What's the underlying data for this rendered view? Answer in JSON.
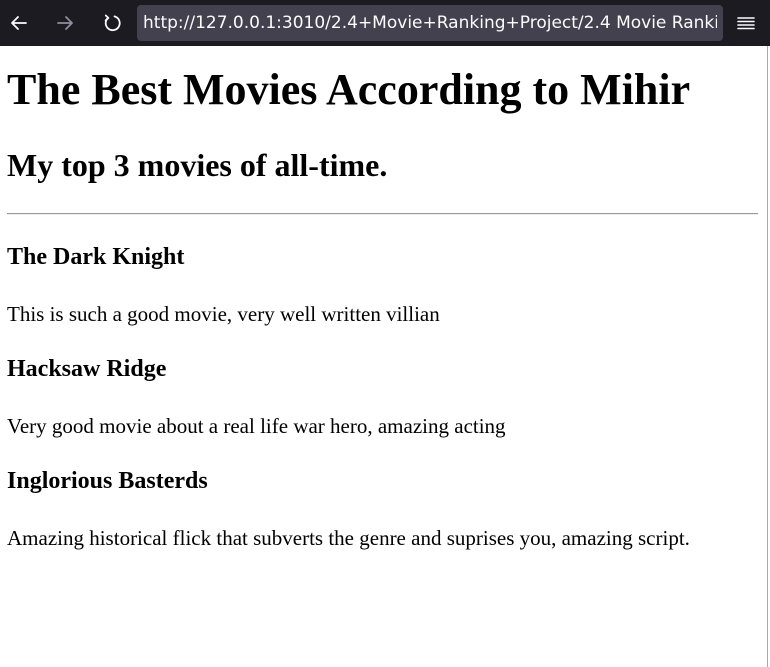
{
  "browser": {
    "url": "http://127.0.0.1:3010/2.4+Movie+Ranking+Project/2.4 Movie Rankir"
  },
  "page": {
    "title": "The Best Movies According to Mihir",
    "subtitle": "My top 3 movies of all-time.",
    "movies": [
      {
        "title": "The Dark Knight",
        "description": "This is such a good movie, very well written villian"
      },
      {
        "title": "Hacksaw Ridge",
        "description": "Very good movie about a real life war hero, amazing acting"
      },
      {
        "title": "Inglorious Basterds",
        "description": "Amazing historical flick that subverts the genre and suprises you, amazing script."
      }
    ]
  },
  "colors": {
    "toolbar_bg": "#1c1b22",
    "url_bar_bg": "#42414d",
    "toolbar_icon": "#fbfbfe",
    "toolbar_icon_disabled": "#8f8f9d"
  },
  "icons": {
    "back": "arrow-left-icon",
    "forward": "arrow-right-icon",
    "reload": "reload-icon",
    "menu": "hamburger-menu-icon"
  }
}
